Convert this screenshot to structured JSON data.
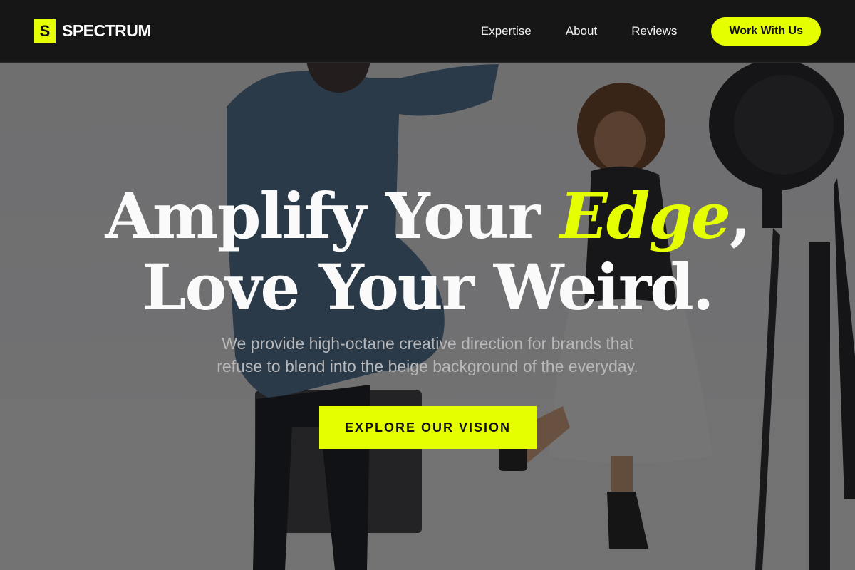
{
  "brand": {
    "mark": "S",
    "name": "SPECTRUM"
  },
  "nav": {
    "links": [
      "Expertise",
      "About",
      "Reviews"
    ],
    "cta_label": "Work With Us"
  },
  "hero": {
    "headline_part1": "Amplify Your ",
    "headline_accent": "Edge",
    "headline_comma": ",",
    "headline_line2": "Love Your Weird.",
    "subtitle_line1": "We provide high-octane creative direction for brands that",
    "subtitle_line2": "refuse to blend into the beige background of the everyday.",
    "cta_label": "EXPLORE OUR VISION"
  },
  "colors": {
    "accent": "#e6ff00",
    "nav_bg": "#161616",
    "text": "#fafafa"
  }
}
